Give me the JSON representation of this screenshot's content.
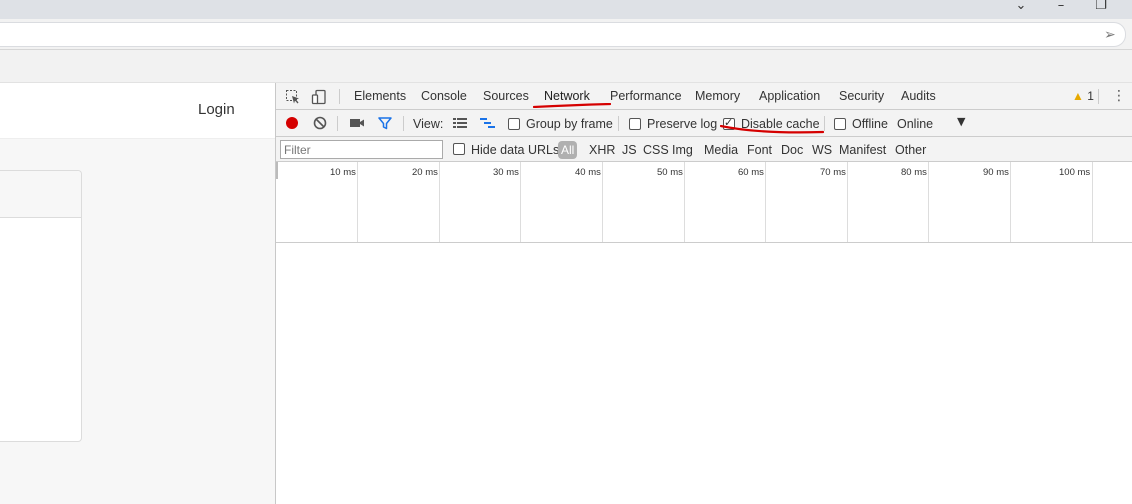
{
  "page": {
    "login_label": "Login"
  },
  "devtools": {
    "tabs": [
      {
        "label": "Elements"
      },
      {
        "label": "Console"
      },
      {
        "label": "Sources"
      },
      {
        "label": "Network",
        "active": true
      },
      {
        "label": "Performance"
      },
      {
        "label": "Memory"
      },
      {
        "label": "Application"
      },
      {
        "label": "Security"
      },
      {
        "label": "Audits"
      }
    ],
    "warning_count": "1",
    "toolbar": {
      "view_label": "View:",
      "group_by_frame_label": "Group by frame",
      "group_by_frame_checked": false,
      "preserve_log_label": "Preserve log",
      "preserve_log_checked": false,
      "disable_cache_label": "Disable cache",
      "disable_cache_checked": true,
      "offline_label": "Offline",
      "offline_checked": false,
      "throttle_value": "Online"
    },
    "filter": {
      "placeholder": "Filter",
      "hide_data_urls_label": "Hide data URLs",
      "types": [
        "All",
        "XHR",
        "JS",
        "CSS",
        "Img",
        "Media",
        "Font",
        "Doc",
        "WS",
        "Manifest",
        "Other"
      ],
      "active_type": "All"
    },
    "timeline": {
      "ticks": [
        "10 ms",
        "20 ms",
        "30 ms",
        "40 ms",
        "50 ms",
        "60 ms",
        "70 ms",
        "80 ms",
        "90 ms",
        "100 ms"
      ]
    }
  },
  "colors": {
    "record": "#d50000",
    "filter_icon": "#1a73e8",
    "annotation": "#d50000",
    "warning": "#e7a900"
  }
}
